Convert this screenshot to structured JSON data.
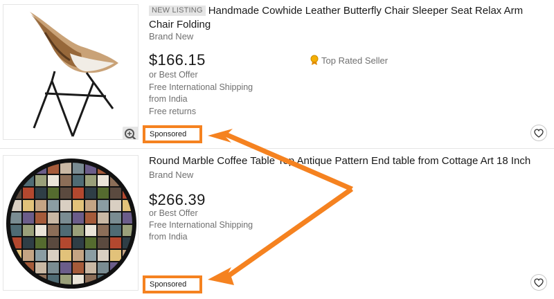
{
  "listings": [
    {
      "badge": "NEW LISTING",
      "title": "Handmade Cowhide Leather Butterfly Chair Sleeper Seat Relax Arm Chair Folding",
      "condition": "Brand New",
      "price": "$166.15",
      "best_offer": "or Best Offer",
      "shipping": "Free International Shipping",
      "location": "from India",
      "returns": "Free returns",
      "seller_badge": "Top Rated Seller",
      "sponsored": "Sponsored",
      "image_icon": "chair-image",
      "zoom_icon": "zoom-in-icon",
      "watch_icon": "heart-icon"
    },
    {
      "title": "Round Marble Coffee Table Top Antique Pattern End table from Cottage Art 18 Inch",
      "condition": "Brand New",
      "price": "$266.39",
      "best_offer": "or Best Offer",
      "shipping": "Free International Shipping",
      "location": "from India",
      "sponsored": "Sponsored",
      "image_icon": "marble-table-image",
      "watch_icon": "heart-icon"
    }
  ],
  "annotation": {
    "arrow_color": "#f58220",
    "highlight_color": "#f58220"
  }
}
